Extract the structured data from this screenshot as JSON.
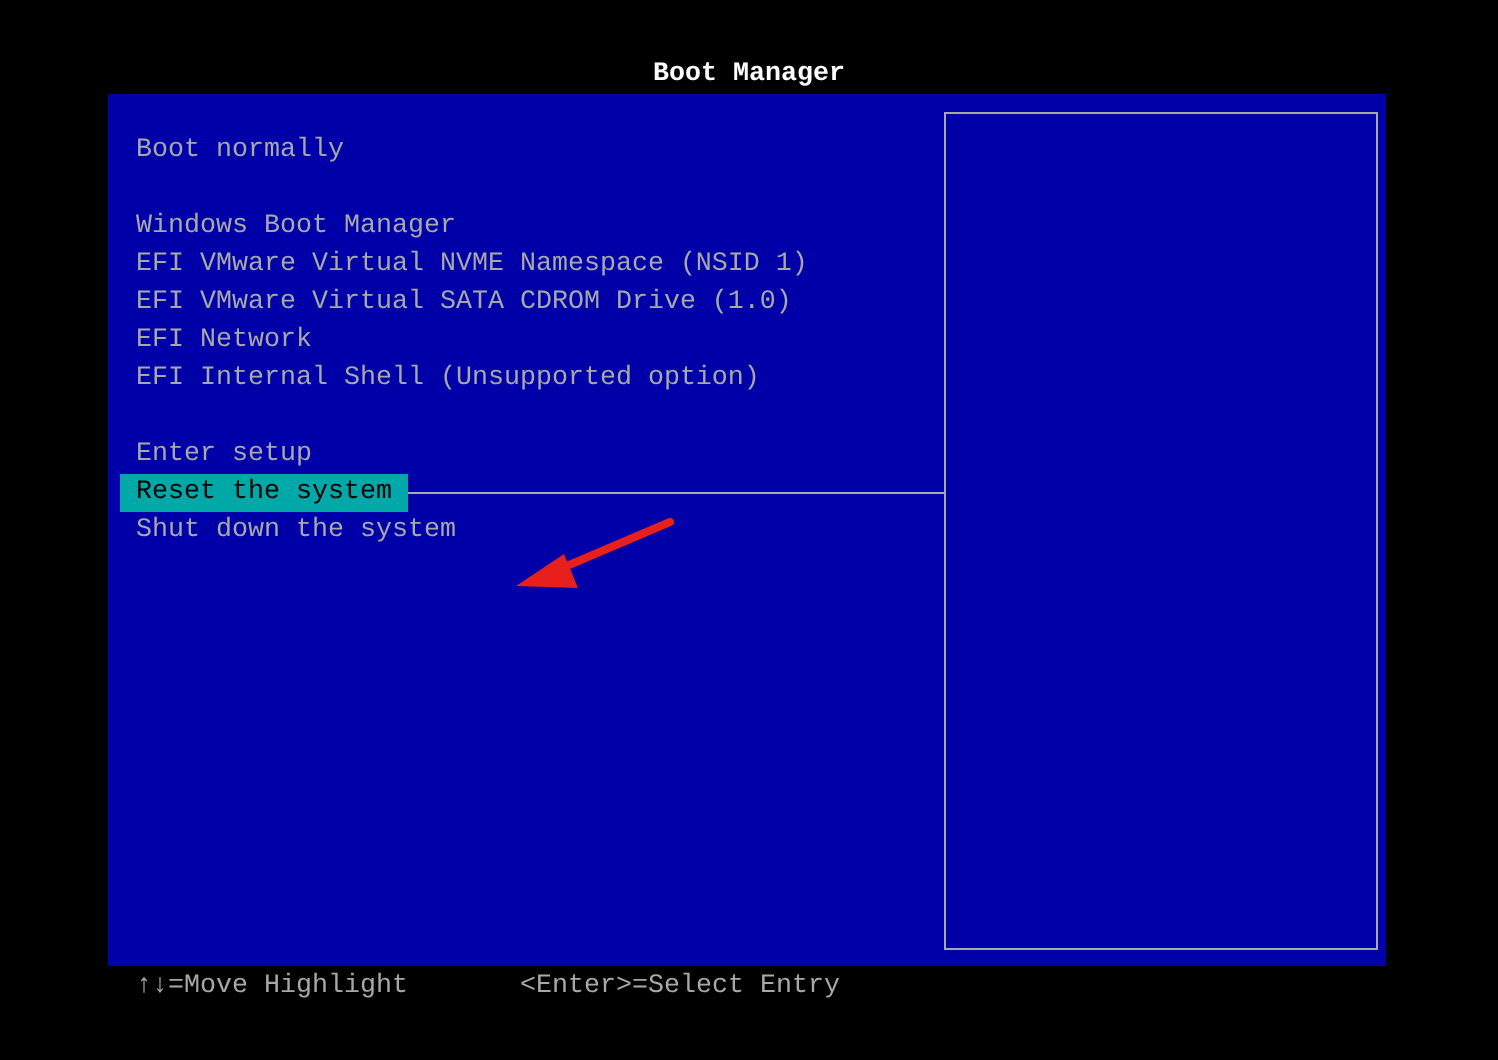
{
  "title": "Boot Manager",
  "menu_groups": [
    [
      {
        "label": "Boot normally",
        "selected": false
      }
    ],
    [
      {
        "label": "Windows Boot Manager",
        "selected": false
      },
      {
        "label": "EFI VMware Virtual NVME Namespace (NSID 1)",
        "selected": false
      },
      {
        "label": "EFI VMware Virtual SATA CDROM Drive (1.0)",
        "selected": false
      },
      {
        "label": "EFI Network",
        "selected": false
      },
      {
        "label": "EFI Internal Shell (Unsupported option)",
        "selected": false
      }
    ],
    [
      {
        "label": "Enter setup",
        "selected": false
      },
      {
        "label": "Reset the system",
        "selected": true
      },
      {
        "label": "Shut down the system",
        "selected": false
      }
    ]
  ],
  "help_keys": [
    "↑↓=Move Highlight",
    "<Enter>=Select Entry"
  ]
}
